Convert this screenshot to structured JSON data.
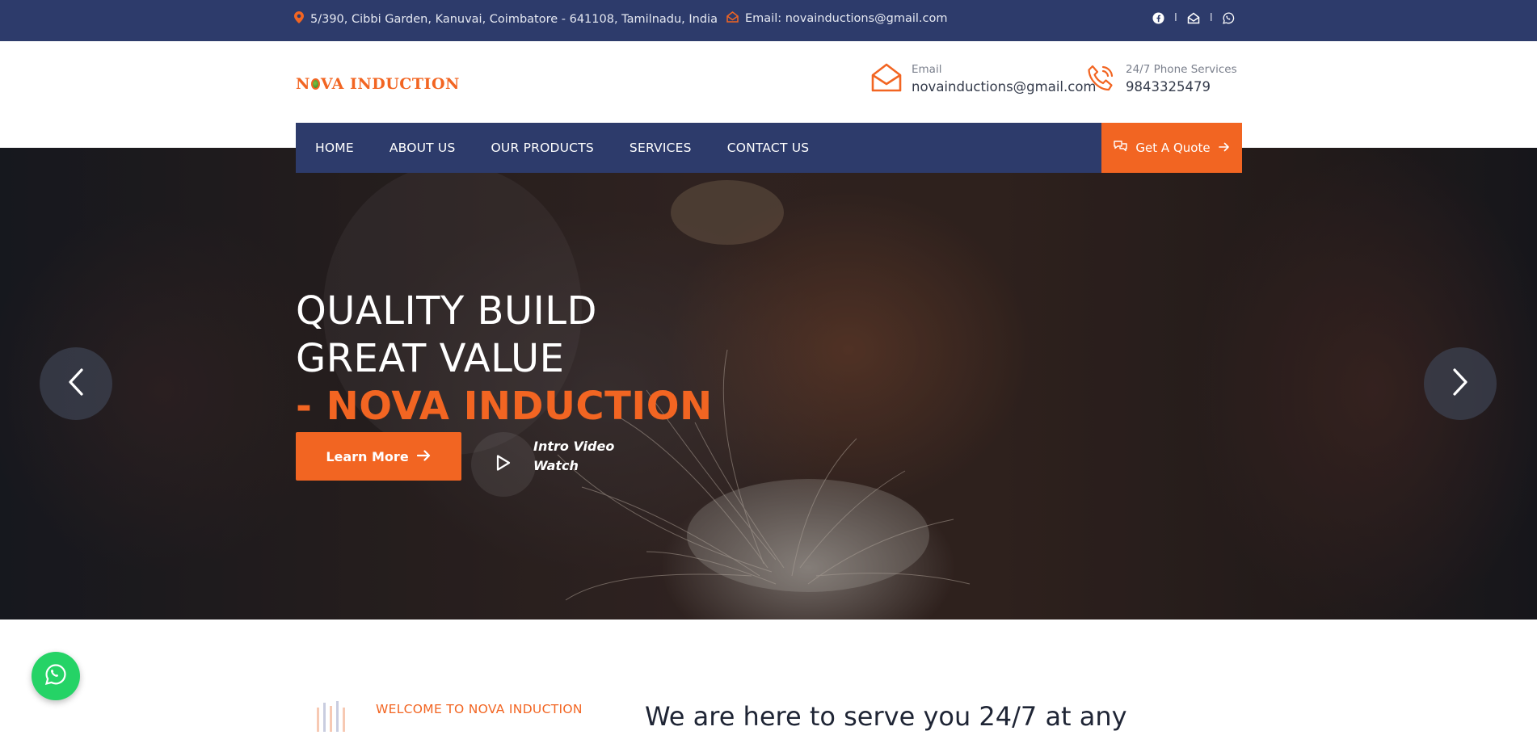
{
  "topbar": {
    "address": "5/390, Cibbi Garden, Kanuvai, Coimbatore - 641108, Tamilnadu, India",
    "email": "Email: novainductions@gmail.com",
    "separator": "I",
    "social_icons": [
      "facebook-icon",
      "mail-icon",
      "whatsapp-icon"
    ]
  },
  "header": {
    "logo_text_pre": "N",
    "logo_text_post": "VA INDUCTION",
    "email_label": "Email",
    "email_value": "novainductions@gmail.com",
    "phone_label": "24/7 Phone Services",
    "phone_value": "9843325479"
  },
  "nav": {
    "items": [
      "HOME",
      "ABOUT US",
      "OUR PRODUCTS",
      "SERVICES",
      "CONTACT US"
    ],
    "quote_label": "Get A Quote"
  },
  "hero": {
    "line1": "QUALITY BUILD",
    "line2": "GREAT VALUE",
    "line3": "- NOVA INDUCTION",
    "learn_more": "Learn More",
    "video_line1": "Intro Video",
    "video_line2": "Watch"
  },
  "welcome": {
    "label": "WELCOME TO NOVA INDUCTION",
    "heading": "We are here to serve you 24/7 at any"
  },
  "colors": {
    "navy": "#2d3b6b",
    "accent": "#f26522",
    "whatsapp": "#25d366"
  }
}
